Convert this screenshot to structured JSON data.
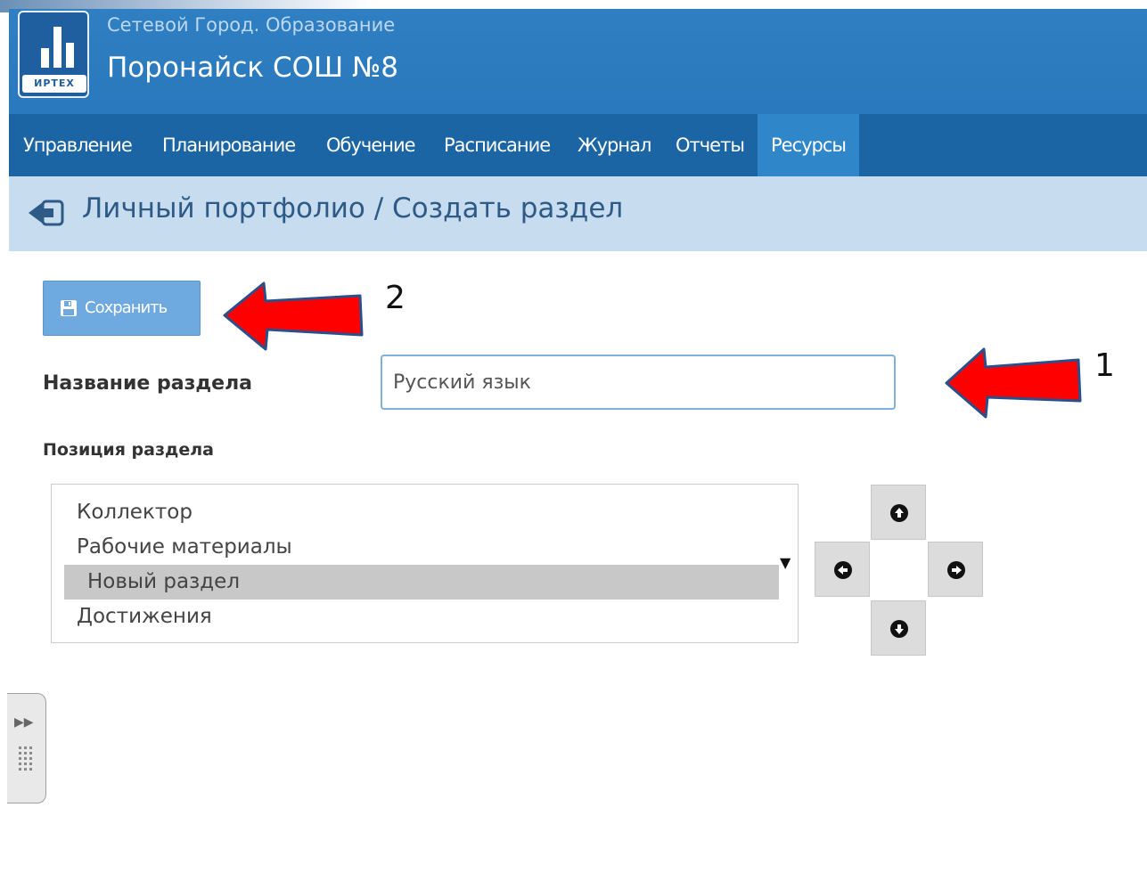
{
  "header": {
    "app_subtitle": "Сетевой Город. Образование",
    "school_name": "Поронайск СОШ №8",
    "logo_caption": "ИРТЕХ"
  },
  "nav": {
    "items": [
      {
        "label": "Управление"
      },
      {
        "label": "Планирование"
      },
      {
        "label": "Обучение"
      },
      {
        "label": "Расписание"
      },
      {
        "label": "Журнал"
      },
      {
        "label": "Отчеты"
      },
      {
        "label": "Ресурсы",
        "active": true
      }
    ]
  },
  "page": {
    "title": "Личный портфолио / Создать раздел"
  },
  "form": {
    "save_label": "Сохранить",
    "name_label": "Название раздела",
    "name_value": "Русский язык",
    "position_label": "Позиция раздела",
    "position_options": [
      {
        "label": "Коллектор"
      },
      {
        "label": "Рабочие материалы"
      },
      {
        "label": "Новый раздел",
        "selected": true
      },
      {
        "label": "Достижения"
      }
    ]
  },
  "annotations": {
    "arrow_1_number": "1",
    "arrow_2_number": "2"
  },
  "icons": {
    "back": "back-arrow-icon",
    "save": "floppy-disk-icon",
    "move_up": "arrow-up-circle-icon",
    "move_left": "arrow-left-circle-icon",
    "move_right": "arrow-right-circle-icon",
    "move_down": "arrow-down-circle-icon",
    "side_panel": "expand-chevron-icon"
  },
  "colors": {
    "header_blue": "#2f7fc2",
    "nav_blue": "#1b65a4",
    "nav_active": "#2f86c9",
    "page_header_bg": "#c7dcef",
    "save_button": "#6ea9df",
    "annotation_arrow": "#ff0000"
  }
}
